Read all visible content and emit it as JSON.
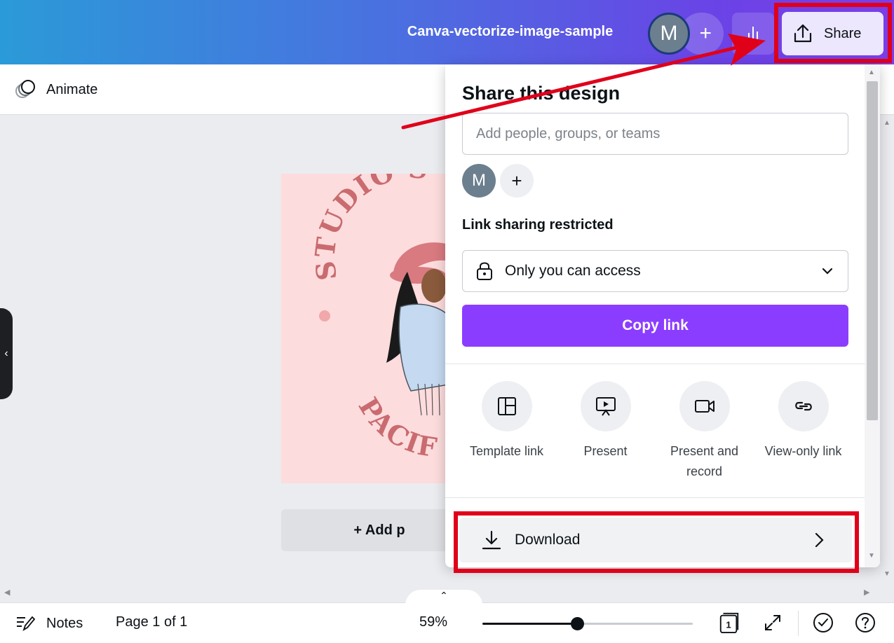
{
  "header": {
    "doc_title": "Canva-vectorize-image-sample",
    "avatar_initial": "M",
    "add_symbol": "+",
    "share_label": "Share",
    "insights_icon": "bar-chart-icon",
    "share_icon": "upload-icon"
  },
  "toolbar": {
    "animate_label": "Animate",
    "animate_icon": "animate-circles-icon"
  },
  "canvas": {
    "design_text_top": "STUDIO S",
    "design_text_bottom": "PACIF",
    "add_page_label": "+ Add p",
    "page_bg_color": "#fddcdd",
    "design_text_color": "#c96b6f"
  },
  "share_panel": {
    "title": "Share this design",
    "people_placeholder": "Add people, groups, or teams",
    "member_initial": "M",
    "add_member_symbol": "+",
    "link_section_label": "Link sharing restricted",
    "access_value": "Only you can access",
    "copy_link_label": "Copy link",
    "copy_link_color": "#8b3dff",
    "options": [
      {
        "label": "Template link",
        "icon": "template-layout-icon"
      },
      {
        "label": "Present",
        "icon": "present-screen-icon"
      },
      {
        "label": "Present and record",
        "icon": "video-camera-icon"
      },
      {
        "label": "View-only link",
        "icon": "link-icon"
      }
    ],
    "download_label": "Download",
    "download_icon": "download-icon"
  },
  "footer": {
    "notes_label": "Notes",
    "page_info": "Page 1 of 1",
    "zoom_label": "59%",
    "zoom_fraction": 0.45,
    "page_count_badge": "1"
  },
  "annotations": {
    "highlight_color": "#e0001a"
  }
}
